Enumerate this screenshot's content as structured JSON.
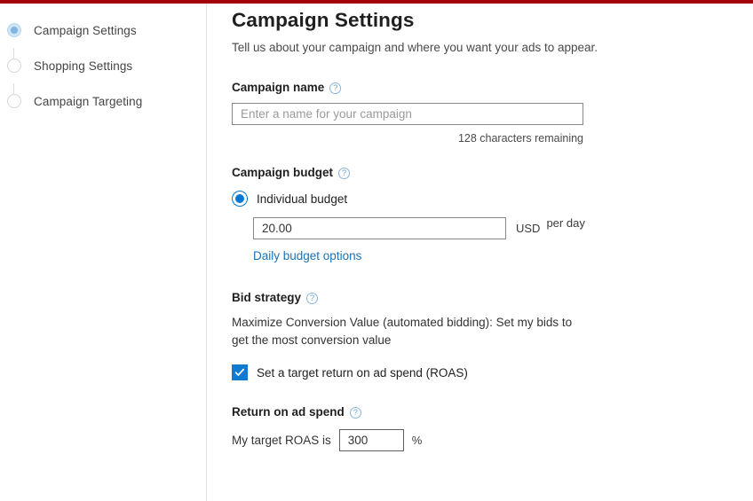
{
  "theme": {
    "accent_bar_color": "#a4000a",
    "primary_blue": "#0078d4",
    "link_blue": "#1b72b8"
  },
  "sidebar": {
    "steps": [
      {
        "label": "Campaign Settings",
        "state": "current"
      },
      {
        "label": "Shopping Settings",
        "state": "upcoming"
      },
      {
        "label": "Campaign Targeting",
        "state": "upcoming"
      }
    ]
  },
  "main": {
    "title": "Campaign Settings",
    "subtitle": "Tell us about your campaign and where you want your ads to appear.",
    "campaign_name": {
      "label": "Campaign name",
      "help_icon": "help-circle-icon",
      "placeholder": "Enter a name for your campaign",
      "value": "",
      "characters_remaining": "128 characters remaining"
    },
    "campaign_budget": {
      "label": "Campaign budget",
      "help_icon": "help-circle-icon",
      "radio_label": "Individual budget",
      "radio_checked": true,
      "amount": "20.00",
      "currency": "USD",
      "period": "per day",
      "options_link": "Daily budget options"
    },
    "bid_strategy": {
      "label": "Bid strategy",
      "help_icon": "help-circle-icon",
      "description": "Maximize Conversion Value (automated bidding): Set my bids to get the most conversion value",
      "checkbox_label": "Set a target return on ad spend (ROAS)",
      "checkbox_checked": true
    },
    "return_on_ad_spend": {
      "label": "Return on ad spend",
      "help_icon": "help-circle-icon",
      "prefix_text": "My target ROAS is",
      "value": "300",
      "suffix_unit": "%"
    }
  }
}
